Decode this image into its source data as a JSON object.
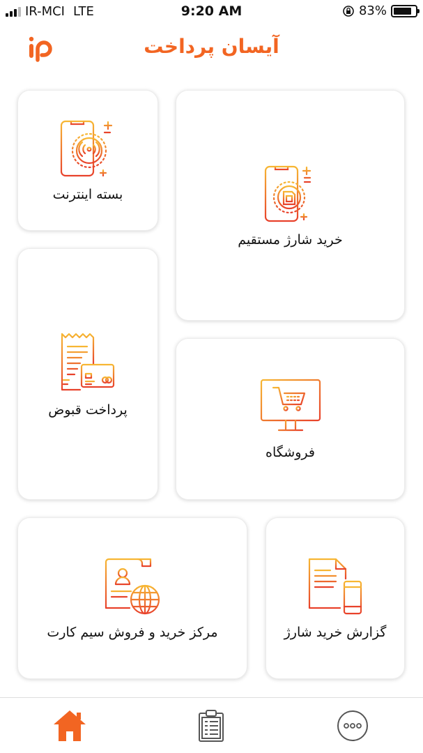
{
  "status_bar": {
    "carrier": "IR-MCI",
    "network": "LTE",
    "time": "9:20 AM",
    "battery_percent": "83%",
    "battery_level": 0.83
  },
  "header": {
    "title": "آیسان پرداخت",
    "logo_text": "ip"
  },
  "tiles": {
    "direct_charge": {
      "label": "خرید شارژ مستقیم",
      "icon": "sim-card-phone-icon"
    },
    "internet": {
      "label": "بسته اینترنت",
      "icon": "antenna-phone-icon"
    },
    "bills": {
      "label": "پرداخت قبوض",
      "icon": "receipt-card-icon"
    },
    "shop": {
      "label": "فروشگاه",
      "icon": "shopping-cart-monitor-icon"
    },
    "sim_center": {
      "label": "مرکز خرید و فروش سیم کارت",
      "icon": "document-globe-icon"
    },
    "report": {
      "label": "گزارش خرید شارژ",
      "icon": "document-phone-icon"
    }
  },
  "tabbar": {
    "items": [
      {
        "name": "home",
        "icon": "home-icon",
        "active": true
      },
      {
        "name": "reports",
        "icon": "clipboard-icon",
        "active": false
      },
      {
        "name": "more",
        "icon": "more-icon",
        "active": false
      }
    ]
  },
  "colors": {
    "accent": "#F26522",
    "gradient_top": "#F7B733",
    "gradient_bottom": "#E8412B",
    "tab_inactive": "#555555"
  }
}
